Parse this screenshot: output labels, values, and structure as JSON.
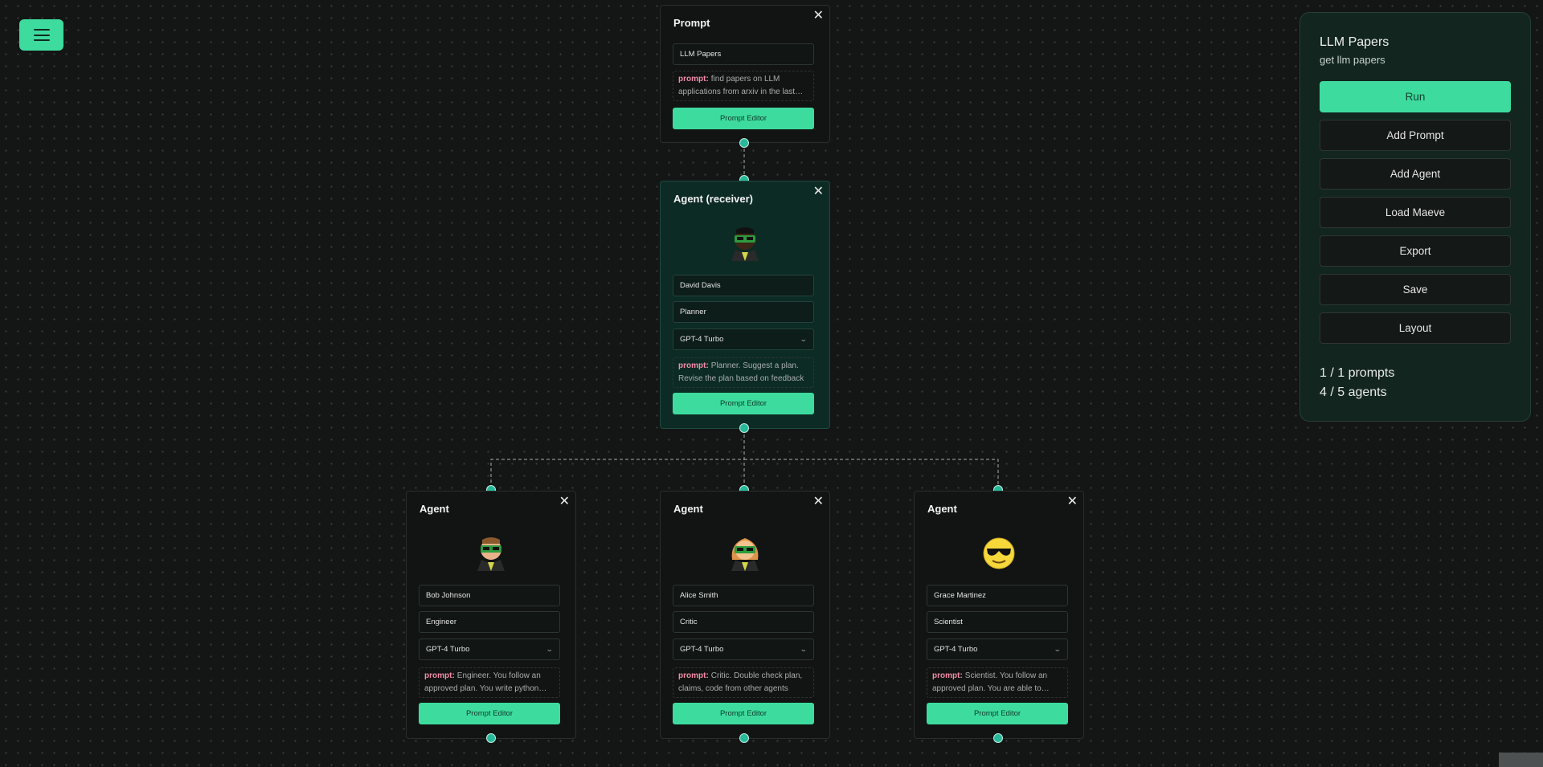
{
  "menu": {
    "icon": "hamburger-menu-icon"
  },
  "prompt_node": {
    "title": "Prompt",
    "name_value": "LLM Papers",
    "prompt_label": "prompt:",
    "prompt_text": "find papers on LLM applications from arxiv in the last week",
    "editor_button": "Prompt Editor"
  },
  "receiver_node": {
    "title": "Agent (receiver)",
    "name_value": "David Davis",
    "role_value": "Planner",
    "model_value": "GPT-4 Turbo",
    "prompt_label": "prompt:",
    "prompt_text": "Planner. Suggest a plan. Revise the plan based on feedback",
    "editor_button": "Prompt Editor"
  },
  "agents": [
    {
      "title": "Agent",
      "name_value": "Bob Johnson",
      "role_value": "Engineer",
      "model_value": "GPT-4 Turbo",
      "prompt_label": "prompt:",
      "prompt_text": "Engineer. You follow an approved plan. You write python code",
      "editor_button": "Prompt Editor"
    },
    {
      "title": "Agent",
      "name_value": "Alice Smith",
      "role_value": "Critic",
      "model_value": "GPT-4 Turbo",
      "prompt_label": "prompt:",
      "prompt_text": "Critic. Double check plan, claims, code from other agents",
      "editor_button": "Prompt Editor"
    },
    {
      "title": "Agent",
      "name_value": "Grace Martinez",
      "role_value": "Scientist",
      "model_value": "GPT-4 Turbo",
      "prompt_label": "prompt:",
      "prompt_text": "Scientist. You follow an approved plan. You are able to categorize papers",
      "editor_button": "Prompt Editor"
    }
  ],
  "panel": {
    "title": "LLM Papers",
    "subtitle": "get llm papers",
    "buttons": {
      "run": "Run",
      "add_prompt": "Add Prompt",
      "add_agent": "Add Agent",
      "load": "Load Maeve",
      "export": "Export",
      "save": "Save",
      "layout": "Layout"
    },
    "prompts_count": "1 / 1 prompts",
    "agents_count": "4 / 5 agents"
  },
  "colors": {
    "accent": "#3ddc9e",
    "handle": "#28b89a",
    "background": "#141515",
    "panel": "#12251f",
    "prompt_keyword": "#f28da8"
  }
}
